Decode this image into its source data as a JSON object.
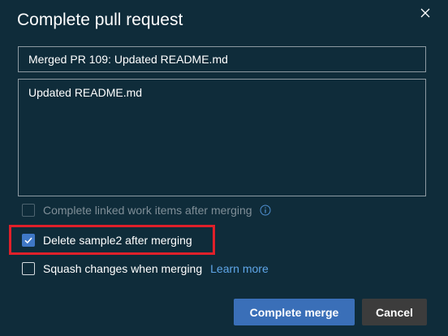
{
  "dialog": {
    "title": "Complete pull request",
    "close_icon": "close-icon"
  },
  "form": {
    "title_value": "Merged PR 109: Updated README.md",
    "description_value": "Updated README.md"
  },
  "options": {
    "complete_work_items": {
      "label": "Complete linked work items after merging",
      "checked": false,
      "disabled": true,
      "info_icon": "info-icon"
    },
    "delete_branch": {
      "label": "Delete sample2 after merging",
      "checked": true
    },
    "squash": {
      "label": "Squash changes when merging",
      "checked": false,
      "link_label": "Learn more"
    }
  },
  "buttons": {
    "complete_label": "Complete merge",
    "cancel_label": "Cancel"
  },
  "colors": {
    "background": "#0f2c3a",
    "primary": "#3a6fb8",
    "link": "#5fa6e8",
    "highlight": "#e0202a"
  }
}
